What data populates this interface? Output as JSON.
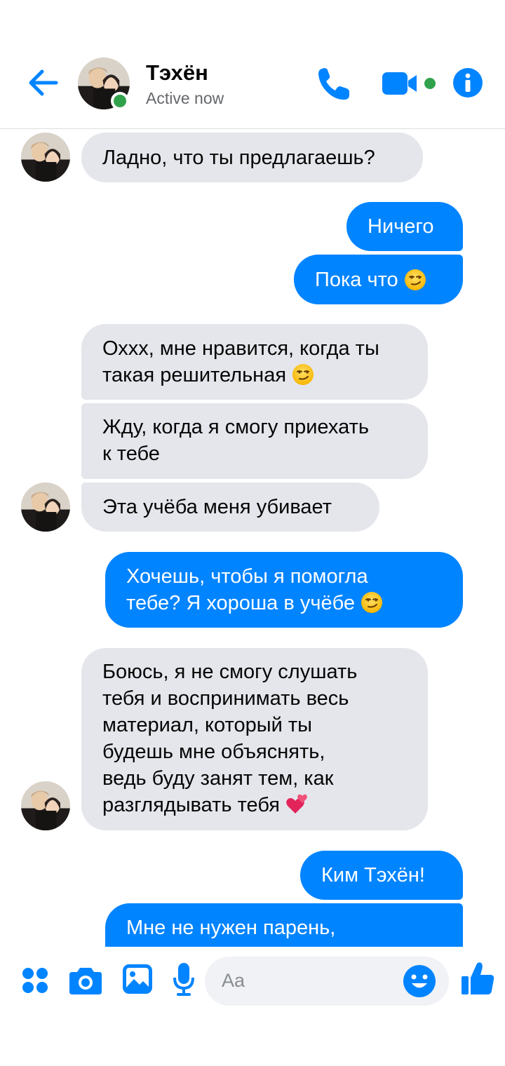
{
  "header": {
    "name": "Тэхён",
    "status": "Active now"
  },
  "messages": [
    {
      "side": "in",
      "text": "Ладно, что ты предлагаешь?"
    },
    {
      "side": "out",
      "text": "Ничего"
    },
    {
      "side": "out",
      "text": "Пока что",
      "emoji": "smirk"
    },
    {
      "side": "in",
      "lines": [
        "Оххх, мне нравится, когда ты",
        "такая решительная"
      ],
      "emoji": "smirk"
    },
    {
      "side": "in",
      "lines": [
        "Жду, когда я смогу приехать",
        "к тебе"
      ]
    },
    {
      "side": "in",
      "text": "Эта учёба меня убивает"
    },
    {
      "side": "out",
      "lines": [
        "Хочешь, чтобы я помогла",
        "тебе? Я хороша в учёбе"
      ],
      "emoji": "smirk"
    },
    {
      "side": "in",
      "lines": [
        "Боюсь, я не смогу слушать",
        "тебя и воспринимать весь",
        "материал, который ты",
        "будешь мне объяснять,",
        "ведь буду занят тем, как",
        "разглядывать тебя"
      ],
      "emoji": "two-hearts"
    },
    {
      "side": "out",
      "text": "Ким Тэхён!"
    },
    {
      "side": "out",
      "text": "Мне не нужен парень,"
    }
  ],
  "composer": {
    "placeholder": "Aa"
  },
  "colors": {
    "accent": "#0084ff",
    "incoming_bubble": "#e4e6eb",
    "online": "#31a24c"
  },
  "icons": [
    "back-arrow-icon",
    "phone-icon",
    "video-camera-icon",
    "info-icon",
    "apps-icon",
    "camera-icon",
    "gallery-icon",
    "microphone-icon",
    "smiley-icon",
    "thumbs-up-icon"
  ]
}
